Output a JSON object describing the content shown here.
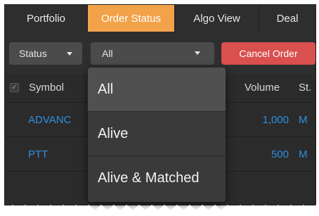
{
  "tabs": [
    {
      "label": "Portfolio",
      "active": false
    },
    {
      "label": "Order Status",
      "active": true
    },
    {
      "label": "Algo View",
      "active": false
    },
    {
      "label": "Deal",
      "active": false
    }
  ],
  "toolbar": {
    "status_label": "Status",
    "filter_value": "All",
    "cancel_label": "Cancel Order"
  },
  "table": {
    "headers": {
      "symbol": "Symbol",
      "volume": "Volume",
      "status": "St."
    },
    "rows": [
      {
        "symbol": "ADVANC",
        "volume": "1,000",
        "status": "M"
      },
      {
        "symbol": "PTT",
        "volume": "500",
        "status": "M"
      }
    ]
  },
  "dropdown": {
    "options": [
      "All",
      "Alive",
      "Alive & Matched"
    ],
    "selected": "All"
  },
  "colors": {
    "accent_tab": "#f2a34a",
    "cancel_button": "#d9504f",
    "link_text": "#2f8fe0",
    "background": "#2b2b2b"
  }
}
